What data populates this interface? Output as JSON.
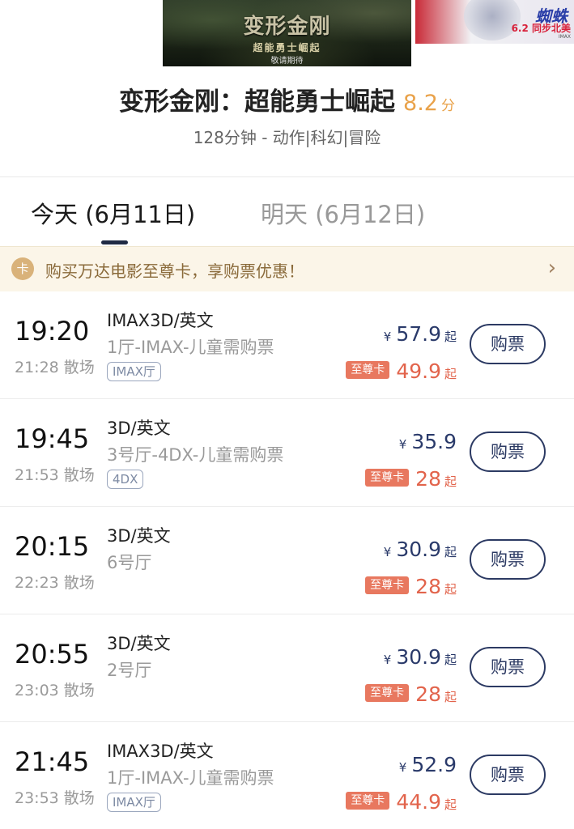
{
  "posters": {
    "main_title": "变形金刚",
    "main_subtitle": "超能勇士崛起",
    "main_tag": "敬请期待",
    "right_headline": "蜘蛛",
    "right_date": "6.2 同步北美",
    "right_fine": "IMAX"
  },
  "movie": {
    "title": "变形金刚：超能勇士崛起",
    "score": "8.2",
    "score_unit": "分",
    "meta": "128分钟 - 动作|科幻|冒险"
  },
  "tabs": [
    {
      "label": "今天 (6月11日)",
      "active": true
    },
    {
      "label": "明天 (6月12日)",
      "active": false
    }
  ],
  "promo": {
    "icon_text": "卡",
    "text": "购买万达电影至尊卡，享购票优惠！",
    "arrow": "›"
  },
  "labels": {
    "yen": "¥",
    "qi": "起",
    "vip": "至尊卡",
    "buy": "购票"
  },
  "showtimes": [
    {
      "start": "19:20",
      "end": "21:28 散场",
      "format": "IMAX3D/英文",
      "hall": "1厅-IMAX-儿童需购票",
      "tag": "IMAX厅",
      "price": "57.9",
      "vip_price": "49.9"
    },
    {
      "start": "19:45",
      "end": "21:53 散场",
      "format": "3D/英文",
      "hall": "3号厅-4DX-儿童需购票",
      "tag": "4DX",
      "price": "35.9",
      "vip_price": "28"
    },
    {
      "start": "20:15",
      "end": "22:23 散场",
      "format": "3D/英文",
      "hall": "6号厅",
      "tag": "",
      "price": "30.9",
      "vip_price": "28"
    },
    {
      "start": "20:55",
      "end": "23:03 散场",
      "format": "3D/英文",
      "hall": "2号厅",
      "tag": "",
      "price": "30.9",
      "vip_price": "28"
    },
    {
      "start": "21:45",
      "end": "23:53 散场",
      "format": "IMAX3D/英文",
      "hall": "1厅-IMAX-儿童需购票",
      "tag": "IMAX厅",
      "price": "52.9",
      "vip_price": "44.9"
    }
  ]
}
